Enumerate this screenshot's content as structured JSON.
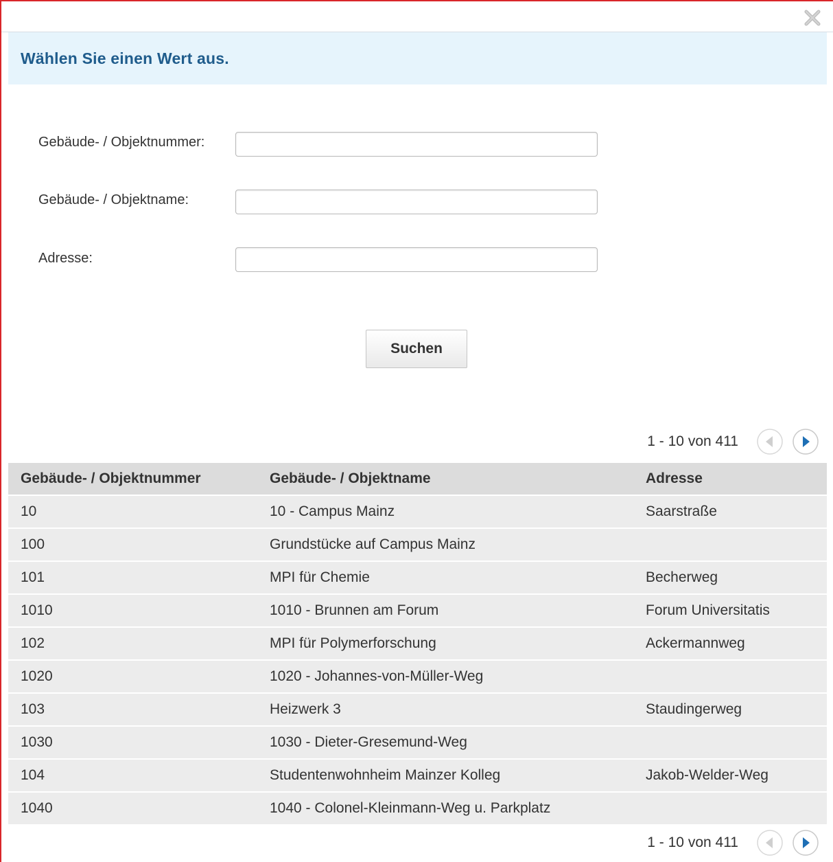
{
  "dialog": {
    "title": "Wählen Sie einen Wert aus.",
    "close_icon": "close-icon"
  },
  "form": {
    "fields": [
      {
        "label": "Gebäude- / Objektnummer:",
        "value": "",
        "placeholder": ""
      },
      {
        "label": "Gebäude- / Objektname:",
        "value": "",
        "placeholder": ""
      },
      {
        "label": "Adresse:",
        "value": "",
        "placeholder": ""
      }
    ],
    "search_label": "Suchen"
  },
  "pagination": {
    "range_text": "1 - 10 von 411",
    "prev_icon": "arrow-left-icon",
    "next_icon": "arrow-right-icon"
  },
  "table": {
    "columns": [
      "Gebäude- / Objektnummer",
      "Gebäude- / Objektname",
      "Adresse"
    ],
    "rows": [
      [
        "10",
        "10 - Campus Mainz",
        "Saarstraße"
      ],
      [
        "100",
        "Grundstücke auf Campus Mainz",
        ""
      ],
      [
        "101",
        "MPI für Chemie",
        "Becherweg"
      ],
      [
        "1010",
        "1010 - Brunnen am Forum",
        "Forum Universitatis"
      ],
      [
        "102",
        "MPI für Polymerforschung",
        "Ackermannweg"
      ],
      [
        "1020",
        "1020 - Johannes-von-Müller-Weg",
        ""
      ],
      [
        "103",
        "Heizwerk 3",
        "Staudingerweg"
      ],
      [
        "1030",
        "1030 - Dieter-Gresemund-Weg",
        ""
      ],
      [
        "104",
        "Studentenwohnheim Mainzer Kolleg",
        "Jakob-Welder-Weg"
      ],
      [
        "1040",
        "1040 - Colonel-Kleinmann-Weg u. Parkplatz",
        ""
      ]
    ]
  },
  "colors": {
    "accent": "#1f5c8c",
    "header_bg": "#e6f4fc",
    "border_red": "#d9262a",
    "nav_blue": "#1e6fb5"
  }
}
